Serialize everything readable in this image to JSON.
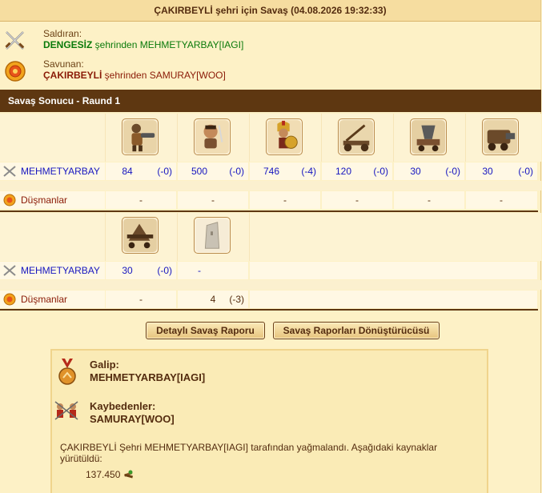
{
  "title": "ÇAKIRBEYLİ şehri için Savaş (04.08.2026 19:32:33)",
  "attacker": {
    "label": "Saldıran:",
    "city": "DENGESİZ",
    "rest": " şehrinden MEHMETYARBAY[IAGI]"
  },
  "defender": {
    "label": "Savunan:",
    "city": "ÇAKIRBEYLİ",
    "rest": " şehrinden SAMURAY[WOO]"
  },
  "round_header": "Savaş Sonucu - Raund 1",
  "block1": {
    "units": [
      {
        "icon": "soldier-cannon-icon"
      },
      {
        "icon": "swordsman-icon"
      },
      {
        "icon": "hoplite-icon"
      },
      {
        "icon": "catapult-icon"
      },
      {
        "icon": "mortar-icon"
      },
      {
        "icon": "steam-ram-icon"
      }
    ],
    "player": {
      "name": "MEHMETYARBAY",
      "values": [
        {
          "v": "84",
          "d": "(-0)"
        },
        {
          "v": "500",
          "d": "(-0)"
        },
        {
          "v": "746",
          "d": "(-4)"
        },
        {
          "v": "120",
          "d": "(-0)"
        },
        {
          "v": "30",
          "d": "(-0)"
        },
        {
          "v": "30",
          "d": "(-0)"
        }
      ]
    },
    "enemy": {
      "name": "Düşmanlar",
      "values": [
        {
          "v": "-",
          "d": ""
        },
        {
          "v": "-",
          "d": ""
        },
        {
          "v": "-",
          "d": ""
        },
        {
          "v": "-",
          "d": ""
        },
        {
          "v": "-",
          "d": ""
        },
        {
          "v": "-",
          "d": ""
        }
      ]
    }
  },
  "block2": {
    "units": [
      {
        "icon": "ram-icon"
      },
      {
        "icon": "wall-icon"
      }
    ],
    "player": {
      "name": "MEHMETYARBAY",
      "values": [
        {
          "v": "30",
          "d": "(-0)"
        },
        {
          "v": "-",
          "d": ""
        }
      ]
    },
    "enemy": {
      "name": "Düşmanlar",
      "values": [
        {
          "v": "-",
          "d": ""
        },
        {
          "v": "4",
          "d": "(-3)"
        }
      ]
    }
  },
  "buttons": {
    "detailed": "Detaylı Savaş Raporu",
    "converter": "Savaş Raporları Dönüştürücüsü"
  },
  "summary": {
    "winner_label": "Galip:",
    "winner": "MEHMETYARBAY[IAGI]",
    "loser_label": "Kaybedenler:",
    "loser": "SAMURAY[WOO]",
    "text": "ÇAKIRBEYLİ Şehri MEHMETYARBAY[IAGI] tarafından yağmalandı. Aşağıdaki kaynaklar yürütüldü:",
    "resource_amount": "137.450",
    "resource_icon": "wood-icon"
  }
}
